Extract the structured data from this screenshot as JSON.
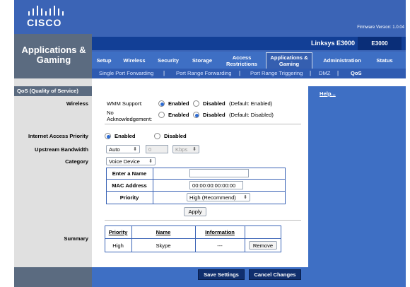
{
  "header": {
    "brand": "CISCO",
    "firmware": "Firmware Version: 1.0.04",
    "section_title": "Applications & Gaming",
    "model_name": "Linksys E3000",
    "model_code": "E3000"
  },
  "tabs": [
    {
      "label": "Setup"
    },
    {
      "label": "Wireless"
    },
    {
      "label": "Security"
    },
    {
      "label": "Storage"
    },
    {
      "label": "Access Restrictions"
    },
    {
      "label": "Applications & Gaming"
    },
    {
      "label": "Administration"
    },
    {
      "label": "Status"
    }
  ],
  "subtabs": [
    {
      "label": "Single Port Forwarding"
    },
    {
      "label": "Port Range Forwarding"
    },
    {
      "label": "Port Range Triggering"
    },
    {
      "label": "DMZ"
    },
    {
      "label": "QoS"
    }
  ],
  "left": {
    "section": "QoS (Quality of Service)",
    "wireless": "Wireless",
    "iap": "Internet Access Priority",
    "upstream": "Upstream Bandwidth",
    "category": "Category",
    "summary": "Summary"
  },
  "wireless": {
    "wmm_label": "WMM Support:",
    "wmm_enabled": "Enabled",
    "wmm_disabled": "Disabled",
    "wmm_default": "(Default: Enabled)",
    "noack_label": "No Acknowledgement:",
    "noack_enabled": "Enabled",
    "noack_disabled": "Disabled",
    "noack_default": "(Default: Disabled)"
  },
  "iap": {
    "enabled": "Enabled",
    "disabled": "Disabled"
  },
  "upstream": {
    "mode": "Auto",
    "value": "0",
    "unit": "Kbps"
  },
  "category": {
    "value": "Voice Device"
  },
  "device_form": {
    "name_label": "Enter a Name",
    "name_value": "",
    "mac_label": "MAC Address",
    "mac_value": "00:00:00:00:00:00",
    "priority_label": "Priority",
    "priority_value": "High (Recommend)",
    "apply": "Apply"
  },
  "summary": {
    "columns": [
      "Priority",
      "Name",
      "Information"
    ],
    "rows": [
      {
        "priority": "High",
        "name": "Skype",
        "info": "---",
        "action": "Remove"
      }
    ]
  },
  "footer": {
    "save": "Save Settings",
    "cancel": "Cancel Changes"
  },
  "help": {
    "label": "Help..."
  },
  "colors": {
    "primary_blue": "#3b64b6",
    "dark_blue": "#123f96",
    "sidebar_grey": "#5b6b80",
    "radio_blue": "#2d6bd2"
  }
}
